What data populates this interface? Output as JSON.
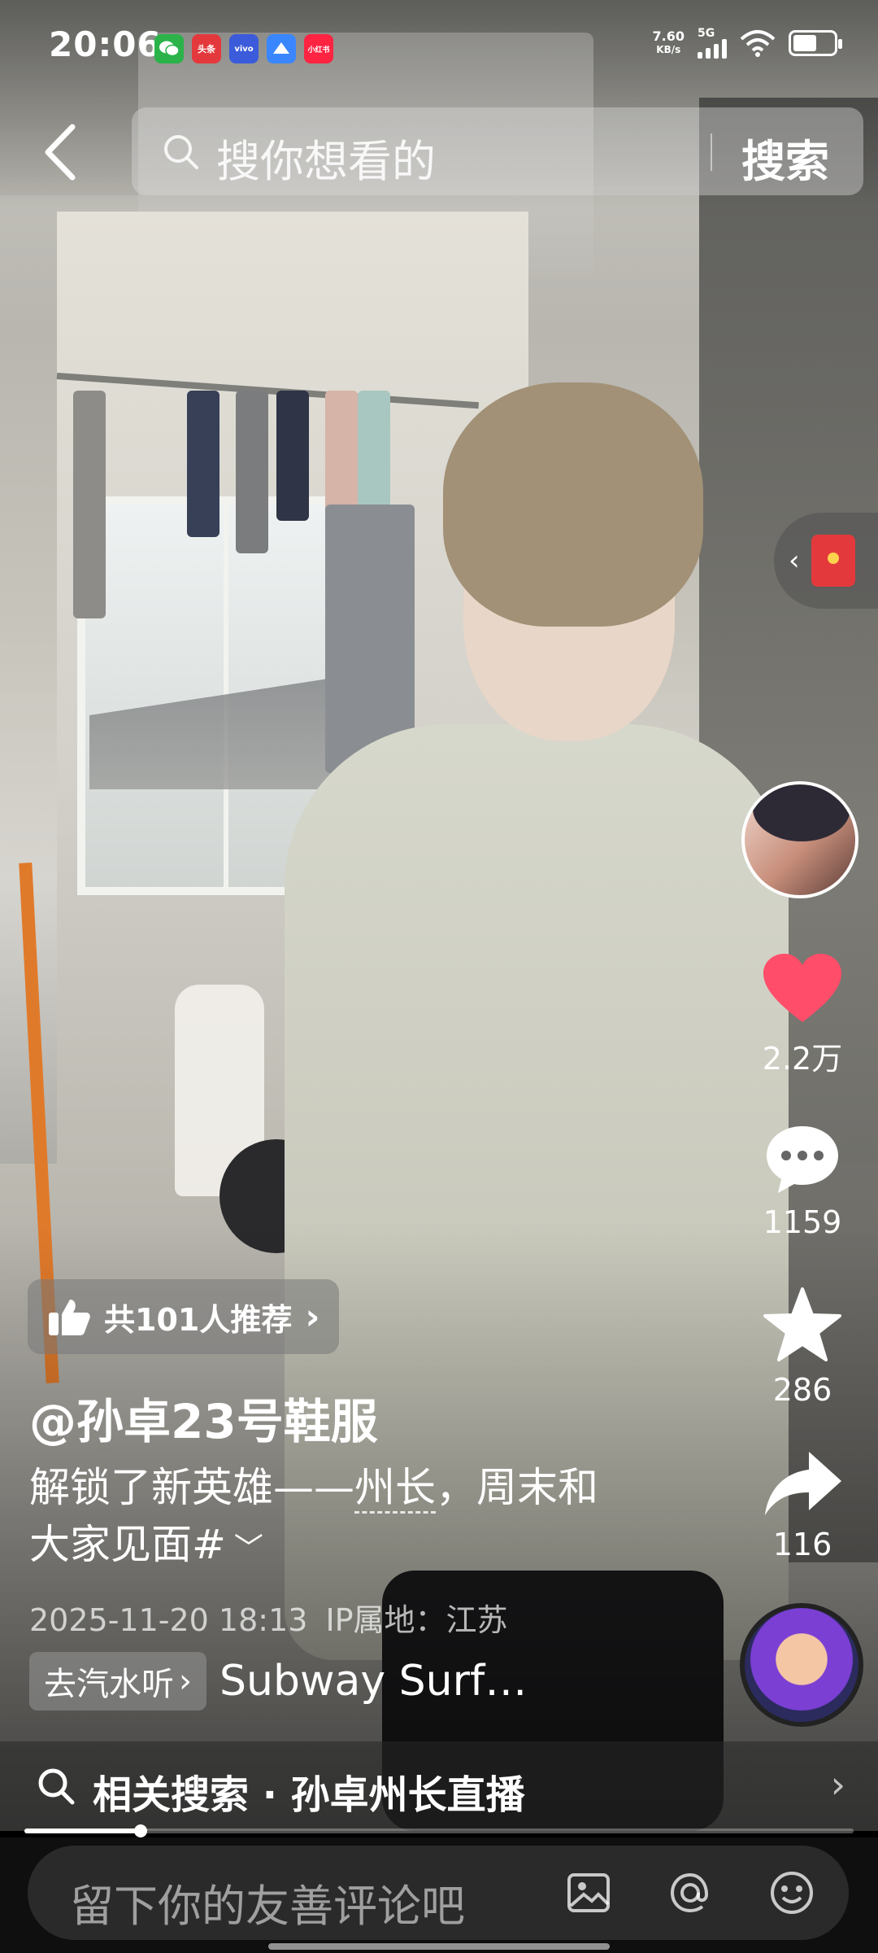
{
  "status_bar": {
    "time": "20:06",
    "apps": [
      {
        "name": "wechat-icon",
        "label": "",
        "color": "#2bb34a"
      },
      {
        "name": "toutiao-icon",
        "label": "头条",
        "color": "#e4393c"
      },
      {
        "name": "vivo-icon",
        "label": "vivo",
        "color": "#3b5bdb"
      },
      {
        "name": "blue-app-icon",
        "label": "",
        "color": "#3a86ff"
      },
      {
        "name": "xiaohongshu-icon",
        "label": "小红书",
        "color": "#ff2442"
      }
    ],
    "speed_value": "7.60",
    "speed_unit": "KB/s",
    "network": "5G"
  },
  "search": {
    "placeholder": "搜你想看的",
    "button_label": "搜索"
  },
  "rail": {
    "likes": "2.2万",
    "comments": "1159",
    "favorites": "286",
    "shares": "116",
    "like_color": "#ff4d6a"
  },
  "recommend": {
    "label": "共101人推荐"
  },
  "caption": {
    "author": "@孙卓23号鞋服",
    "desc_before": "解锁了新英雄——",
    "desc_highlight": "州长",
    "desc_after": "，周末和大家见面#",
    "date": "2025-11-20 18:13",
    "ip": "IP属地：江苏"
  },
  "music": {
    "chip_label": "去汽水听",
    "title": "Subway Surf…"
  },
  "related": {
    "label": "相关搜索 · 孙卓州长直播"
  },
  "progress": {
    "value": 0.14
  },
  "comment": {
    "placeholder": "留下你的友善评论吧"
  }
}
